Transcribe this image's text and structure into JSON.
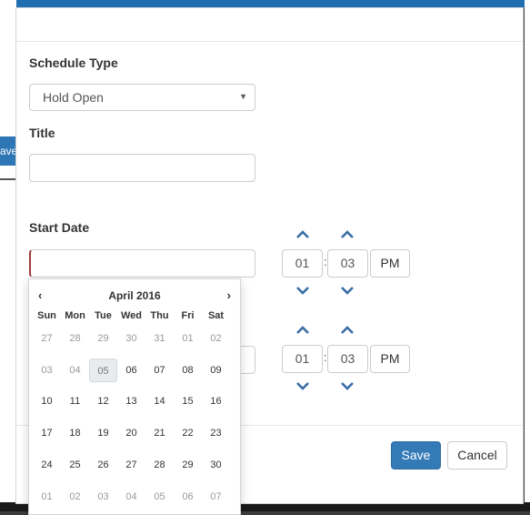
{
  "background": {
    "left_button_label": "ave"
  },
  "form": {
    "schedule_type_label": "Schedule Type",
    "schedule_type_value": "Hold Open",
    "title_label": "Title",
    "title_value": "",
    "start_date_label": "Start Date",
    "start_date_value": "",
    "start_time": {
      "hour": "01",
      "minute": "03",
      "ampm": "PM"
    },
    "end_time": {
      "hour": "01",
      "minute": "03",
      "ampm": "PM"
    }
  },
  "datepicker": {
    "month_label": "April 2016",
    "prev_symbol": "‹",
    "next_symbol": "›",
    "weekdays": [
      "Sun",
      "Mon",
      "Tue",
      "Wed",
      "Thu",
      "Fri",
      "Sat"
    ],
    "weeks": [
      [
        "27",
        "28",
        "29",
        "30",
        "31",
        "01",
        "02"
      ],
      [
        "03",
        "04",
        "05",
        "06",
        "07",
        "08",
        "09"
      ],
      [
        "10",
        "11",
        "12",
        "13",
        "14",
        "15",
        "16"
      ],
      [
        "17",
        "18",
        "19",
        "20",
        "21",
        "22",
        "23"
      ],
      [
        "24",
        "25",
        "26",
        "27",
        "28",
        "29",
        "30"
      ],
      [
        "01",
        "02",
        "03",
        "04",
        "05",
        "06",
        "07"
      ]
    ],
    "today": "05"
  },
  "footer": {
    "save_label": "Save",
    "cancel_label": "Cancel"
  },
  "colors": {
    "primary": "#337ab7",
    "focus_border": "#9c3a3a",
    "chevron": "#3a6ea5"
  }
}
